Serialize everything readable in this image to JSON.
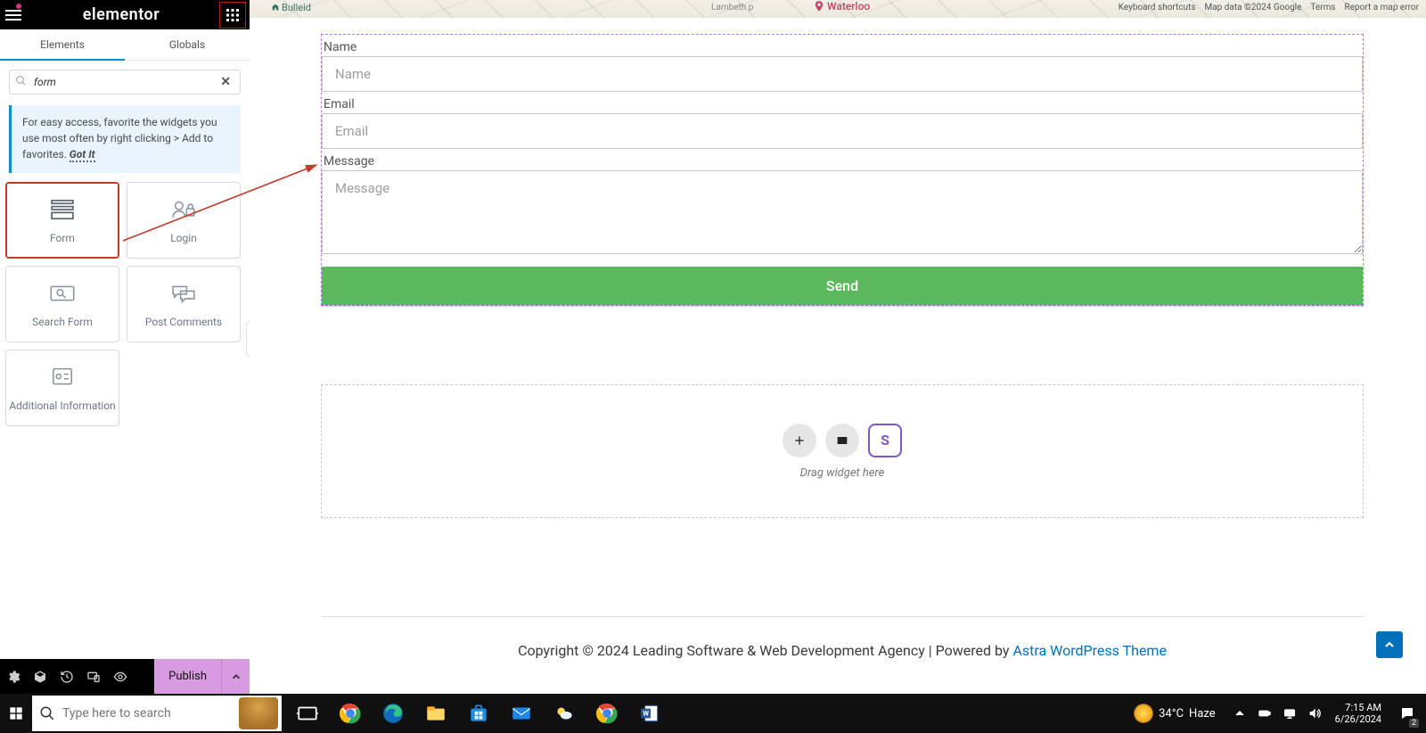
{
  "sidebar": {
    "brand": "elementor",
    "tabs": {
      "elements": "Elements",
      "globals": "Globals"
    },
    "search": {
      "value": "form"
    },
    "tip": {
      "text": "For easy access, favorite the widgets you use most often by right clicking > Add to favorites.",
      "gotit": "Got It"
    },
    "widgets": [
      {
        "label": "Form"
      },
      {
        "label": "Login"
      },
      {
        "label": "Search Form"
      },
      {
        "label": "Post Comments"
      },
      {
        "label": "Additional Information"
      }
    ],
    "footer": {
      "publish": "Publish"
    }
  },
  "map": {
    "bulleid": "Bulleid",
    "lambeth": "Lambeth p",
    "waterloo": "Waterloo",
    "attrib": {
      "shortcuts": "Keyboard shortcuts",
      "data": "Map data ©2024 Google",
      "terms": "Terms",
      "report": "Report a map error"
    }
  },
  "form": {
    "name_label": "Name",
    "name_placeholder": "Name",
    "email_label": "Email",
    "email_placeholder": "Email",
    "message_label": "Message",
    "message_placeholder": "Message",
    "send": "Send"
  },
  "dropzone": {
    "hint": "Drag widget here"
  },
  "page_footer": {
    "text": "Copyright © 2024 Leading Software & Web Development Agency | Powered by ",
    "link": "Astra WordPress Theme"
  },
  "taskbar": {
    "search_placeholder": "Type here to search",
    "weather": {
      "temp": "34°C",
      "cond": "Haze"
    },
    "clock": {
      "time": "7:15 AM",
      "date": "6/26/2024"
    },
    "notif_count": "2"
  }
}
